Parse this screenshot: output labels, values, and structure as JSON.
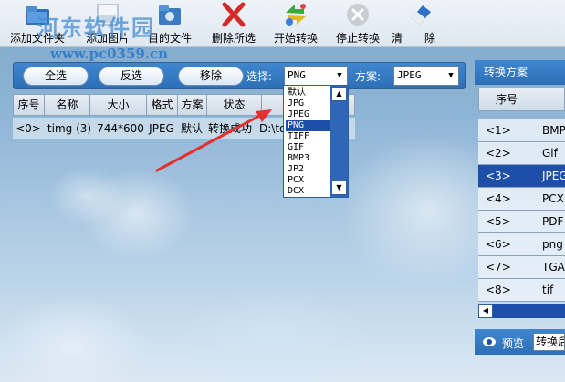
{
  "toolbar": {
    "buttons": [
      {
        "label": "添加文件夹",
        "icon": "folder-add-icon"
      },
      {
        "label": "添加图片",
        "icon": "image-add-icon"
      },
      {
        "label": "目的文件",
        "icon": "destination-folder-icon"
      },
      {
        "label": "删除所选",
        "icon": "red-x-delete-icon"
      },
      {
        "label": "开始转换",
        "icon": "convert-arrows-icon"
      },
      {
        "label": "停止转换",
        "icon": "stop-circle-icon"
      },
      {
        "label": "清",
        "icon": "eraser-icon"
      },
      {
        "label": "除"
      }
    ]
  },
  "watermark": {
    "text": "河东软件园",
    "url": "www.pc0359.cn"
  },
  "controls": {
    "select_all": "全选",
    "invert_select": "反选",
    "remove": "移除",
    "select_label": "选择:",
    "format_value": "PNG",
    "scheme_label": "方案:",
    "scheme_value": "JPEG"
  },
  "table": {
    "headers": [
      "序号",
      "名称",
      "大小",
      "格式",
      "方案",
      "状态"
    ],
    "rows": [
      {
        "index": "<0>",
        "name": "timg (3)",
        "size": "744*600",
        "format": "JPEG",
        "scheme": "默认",
        "status": "转换成功",
        "path": "D:\\to"
      }
    ]
  },
  "format_dropdown": {
    "options": [
      "默认",
      "JPG",
      "JPEG",
      "PNG",
      "TIFF",
      "GIF",
      "BMP3",
      "JP2",
      "PCX",
      "DCX"
    ],
    "selected": "PNG"
  },
  "right_panel": {
    "title": "转换方案",
    "header": "序号",
    "rows": [
      {
        "num": "<1>",
        "fmt": "BMP"
      },
      {
        "num": "<2>",
        "fmt": "Gif"
      },
      {
        "num": "<3>",
        "fmt": "JPEG"
      },
      {
        "num": "<4>",
        "fmt": "PCX"
      },
      {
        "num": "<5>",
        "fmt": "PDF"
      },
      {
        "num": "<6>",
        "fmt": "png"
      },
      {
        "num": "<7>",
        "fmt": "TGA"
      },
      {
        "num": "<8>",
        "fmt": "tif"
      }
    ],
    "selected_index": 2,
    "preview_label": "预览",
    "preview_value": "转换后"
  },
  "colors": {
    "accent": "#2d6fb6",
    "selection": "#1e4fa8",
    "arrow": "#e53030"
  }
}
